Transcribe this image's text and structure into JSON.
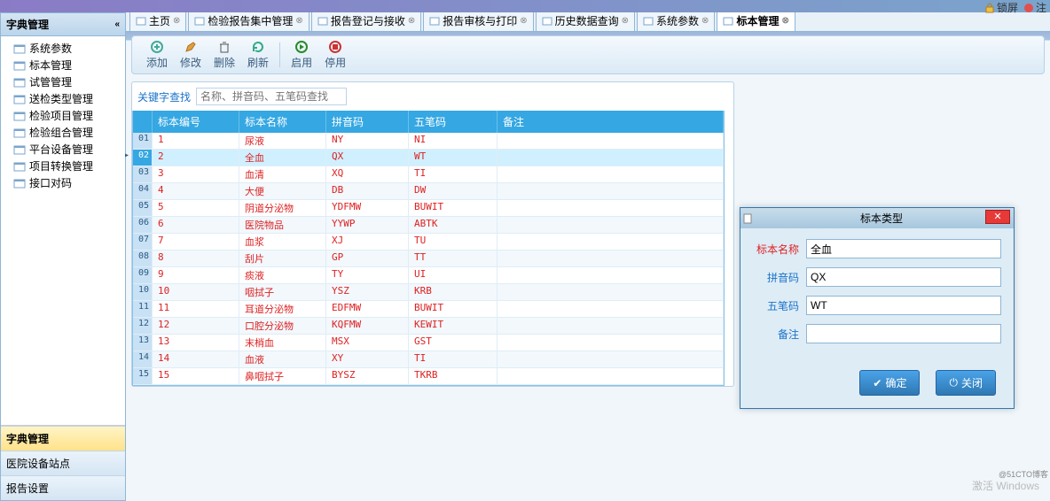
{
  "topbar": {
    "lock": "锁屏",
    "logout": "注"
  },
  "sidebar": {
    "title": "字典管理",
    "items": [
      "系统参数",
      "标本管理",
      "试管管理",
      "送检类型管理",
      "检验项目管理",
      "检验组合管理",
      "平台设备管理",
      "项目转换管理",
      "接口对码"
    ],
    "bottom": [
      "字典管理",
      "医院设备站点",
      "报告设置"
    ]
  },
  "tabs": [
    {
      "label": "主页"
    },
    {
      "label": "检验报告集中管理"
    },
    {
      "label": "报告登记与接收"
    },
    {
      "label": "报告审核与打印"
    },
    {
      "label": "历史数据查询"
    },
    {
      "label": "系统参数"
    },
    {
      "label": "标本管理"
    }
  ],
  "toolbar": {
    "add": "添加",
    "edit": "修改",
    "del": "删除",
    "refresh": "刷新",
    "enable": "启用",
    "disable": "停用"
  },
  "search": {
    "label": "关键字查找",
    "placeholder": "名称、拼音码、五笔码查找"
  },
  "grid": {
    "headers": [
      "",
      "标本编号",
      "标本名称",
      "拼音码",
      "五笔码",
      "备注"
    ],
    "rows": [
      {
        "n": "01",
        "id": "1",
        "name": "尿液",
        "py": "NY",
        "wb": "NI"
      },
      {
        "n": "02",
        "id": "2",
        "name": "全血",
        "py": "QX",
        "wb": "WT"
      },
      {
        "n": "03",
        "id": "3",
        "name": "血清",
        "py": "XQ",
        "wb": "TI"
      },
      {
        "n": "04",
        "id": "4",
        "name": "大便",
        "py": "DB",
        "wb": "DW"
      },
      {
        "n": "05",
        "id": "5",
        "name": "阴道分泌物",
        "py": "YDFMW",
        "wb": "BUWIT"
      },
      {
        "n": "06",
        "id": "6",
        "name": "医院物品",
        "py": "YYWP",
        "wb": "ABTK"
      },
      {
        "n": "07",
        "id": "7",
        "name": "血浆",
        "py": "XJ",
        "wb": "TU"
      },
      {
        "n": "08",
        "id": "8",
        "name": "刮片",
        "py": "GP",
        "wb": "TT"
      },
      {
        "n": "09",
        "id": "9",
        "name": "痰液",
        "py": "TY",
        "wb": "UI"
      },
      {
        "n": "10",
        "id": "10",
        "name": "咽拭子",
        "py": "YSZ",
        "wb": "KRB"
      },
      {
        "n": "11",
        "id": "11",
        "name": "耳道分泌物",
        "py": "EDFMW",
        "wb": "BUWIT"
      },
      {
        "n": "12",
        "id": "12",
        "name": "口腔分泌物",
        "py": "KQFMW",
        "wb": "KEWIT"
      },
      {
        "n": "13",
        "id": "13",
        "name": "末梢血",
        "py": "MSX",
        "wb": "GST"
      },
      {
        "n": "14",
        "id": "14",
        "name": "血液",
        "py": "XY",
        "wb": "TI"
      },
      {
        "n": "15",
        "id": "15",
        "name": "鼻咽拭子",
        "py": "BYSZ",
        "wb": "TKRB"
      }
    ],
    "selected": 1
  },
  "dialog": {
    "title": "标本类型",
    "fields": {
      "name_label": "标本名称",
      "name_val": "全血",
      "py_label": "拼音码",
      "py_val": "QX",
      "wb_label": "五笔码",
      "wb_val": "WT",
      "remark_label": "备注",
      "remark_val": ""
    },
    "ok": "确定",
    "close": "关闭"
  },
  "watermark": {
    "title": "激活 Windows",
    "credit": "@51CTO博客"
  }
}
